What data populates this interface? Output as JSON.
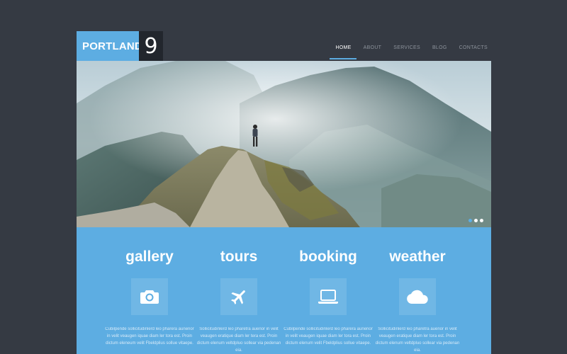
{
  "brand": {
    "name": "PORTLAND",
    "number": "9"
  },
  "nav": {
    "items": [
      {
        "label": "HOME",
        "active": true
      },
      {
        "label": "ABOUT",
        "active": false
      },
      {
        "label": "SERVICES",
        "active": false
      },
      {
        "label": "BLOG",
        "active": false
      },
      {
        "label": "CONTACTS",
        "active": false
      }
    ]
  },
  "slider": {
    "slide_count": 3,
    "active_slide": 1
  },
  "features": [
    {
      "title": "gallery",
      "icon": "camera-icon",
      "text": "Cubilpende sollicitudinlerd leo pharera aunenor in velit veaugen iquae diam ler tora est. Proin dictum eleneum velit Fbeldplius sollue vitaepe."
    },
    {
      "title": "tours",
      "icon": "plane-icon",
      "text": "Sollicitudinlerd leo pharetra auenor in velit veaugen eratique diam ler tera est. Proin dictum elenum veltdpluo sollear via pedenan eia."
    },
    {
      "title": "booking",
      "icon": "laptop-icon",
      "text": "Cubilpende sollicitudinlerd leo pharera aunenor in velit veaugen iquae diam ler tora est. Proin dictum elenum velit Fbeldplius sollue vitaepe."
    },
    {
      "title": "weather",
      "icon": "cloud-icon",
      "text": "Sollicitudinlerd leo pharetra auenor in velit veaugen eratique diam ler tora est. Proin dictum elenum veltdpluo sollear via pedenan eia."
    }
  ],
  "colors": {
    "background": "#353a43",
    "accent": "#5dade2",
    "logo_dark": "#22262d"
  }
}
